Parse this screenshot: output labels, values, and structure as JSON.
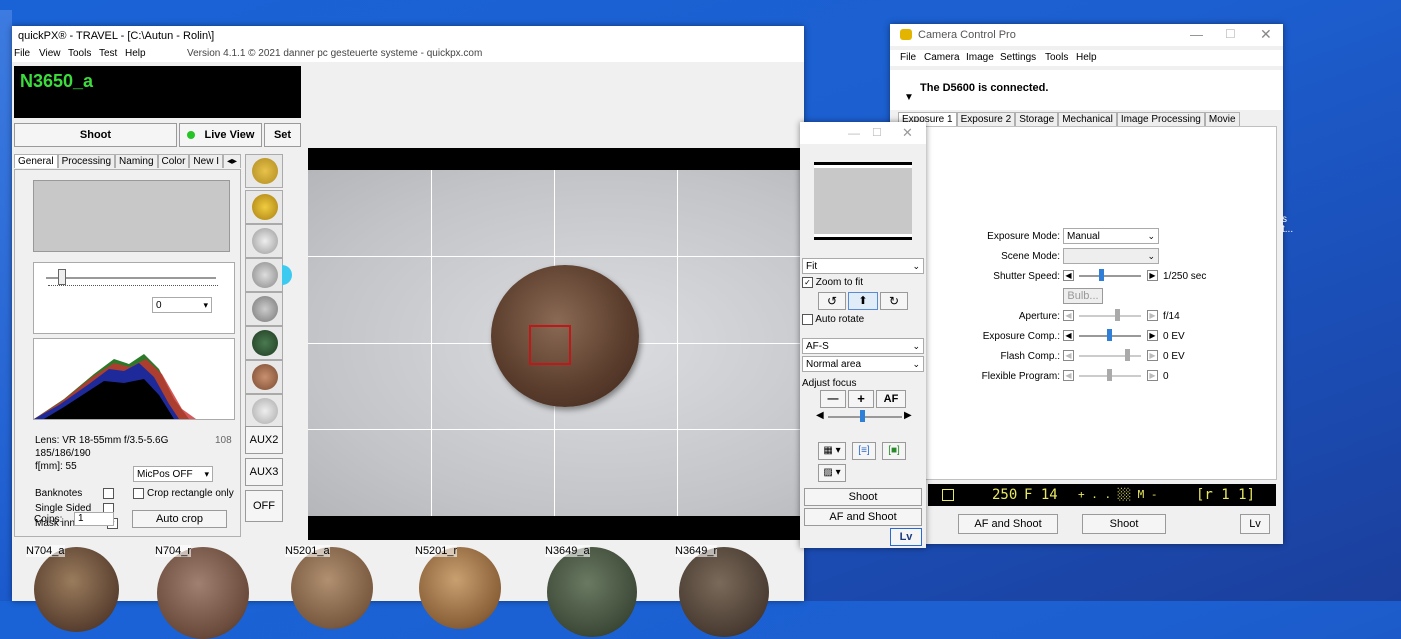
{
  "quickpx": {
    "title": "quickPX® - TRAVEL - [C:\\Autun - Rolin\\]",
    "menu": [
      "File",
      "View",
      "Tools",
      "Test",
      "Help"
    ],
    "version": "Version 4.1.1  © 2021 danner pc gesteuerte systeme - quickpx.com",
    "item_id": "N3650_a",
    "shoot": "Shoot",
    "live_view": "Live View",
    "set": "Set",
    "tabs": [
      "General",
      "Processing",
      "Naming",
      "Color",
      "New I"
    ],
    "level_value": "0",
    "lens": "Lens: VR 18-55mm f/3.5-5.6G",
    "lens_num": "108",
    "focal_counts": "185/186/190",
    "fmm": "f[mm]: 55",
    "micpos": "MicPos OFF",
    "banknotes": "Banknotes",
    "crop_rect": "Crop rectangle only",
    "single_sided": "Single Sided",
    "mask_inner": "Mask inner holes",
    "coins_label": "Coins:",
    "coins_value": "1",
    "auto_crop": "Auto crop",
    "aux2": "AUX2",
    "aux3": "AUX3",
    "off": "OFF",
    "thumbnails": [
      "N704_a",
      "N704_r",
      "N5201_a",
      "N5201_r",
      "N3649_a",
      "N3649_r"
    ]
  },
  "liveview": {
    "fit": "Fit",
    "zoom_to_fit": "Zoom to fit",
    "auto_rotate": "Auto rotate",
    "af_mode": "AF-S",
    "area": "Normal area",
    "adjust_focus": "Adjust focus",
    "minus": "—",
    "plus": "+",
    "af": "AF",
    "shoot": "Shoot",
    "af_and_shoot": "AF and Shoot",
    "lv": "Lv"
  },
  "ccp": {
    "title": "Camera Control Pro",
    "menu": [
      "File",
      "Camera",
      "Image",
      "Settings",
      "Tools",
      "Help"
    ],
    "status": "The D5600 is connected.",
    "tabs": [
      "Exposure 1",
      "Exposure 2",
      "Storage",
      "Mechanical",
      "Image Processing",
      "Movie"
    ],
    "exposure_mode_label": "Exposure Mode:",
    "exposure_mode": "Manual",
    "scene_mode_label": "Scene Mode:",
    "shutter_label": "Shutter Speed:",
    "shutter_value": "1/250 sec",
    "bulb": "Bulb...",
    "aperture_label": "Aperture:",
    "aperture_value": "f/14",
    "exp_comp_label": "Exposure Comp.:",
    "exp_comp_value": "0 EV",
    "flash_comp_label": "Flash Comp.:",
    "flash_comp_value": "0 EV",
    "flex_label": "Flexible Program:",
    "flex_value": "0",
    "lcd_shutter": "250",
    "lcd_f": "F 14",
    "lcd_mid": "+ . . ░░ M -",
    "lcd_right": "[r 1 1]",
    "af_and_shoot": "AF and Shoot",
    "shoot": "Shoot",
    "lv": "Lv"
  },
  "colors": {
    "desktop": "#1c5fd0",
    "accent": "#2f7fd8",
    "lcd_bg": "#000000",
    "lcd_text": "#e8e860"
  }
}
